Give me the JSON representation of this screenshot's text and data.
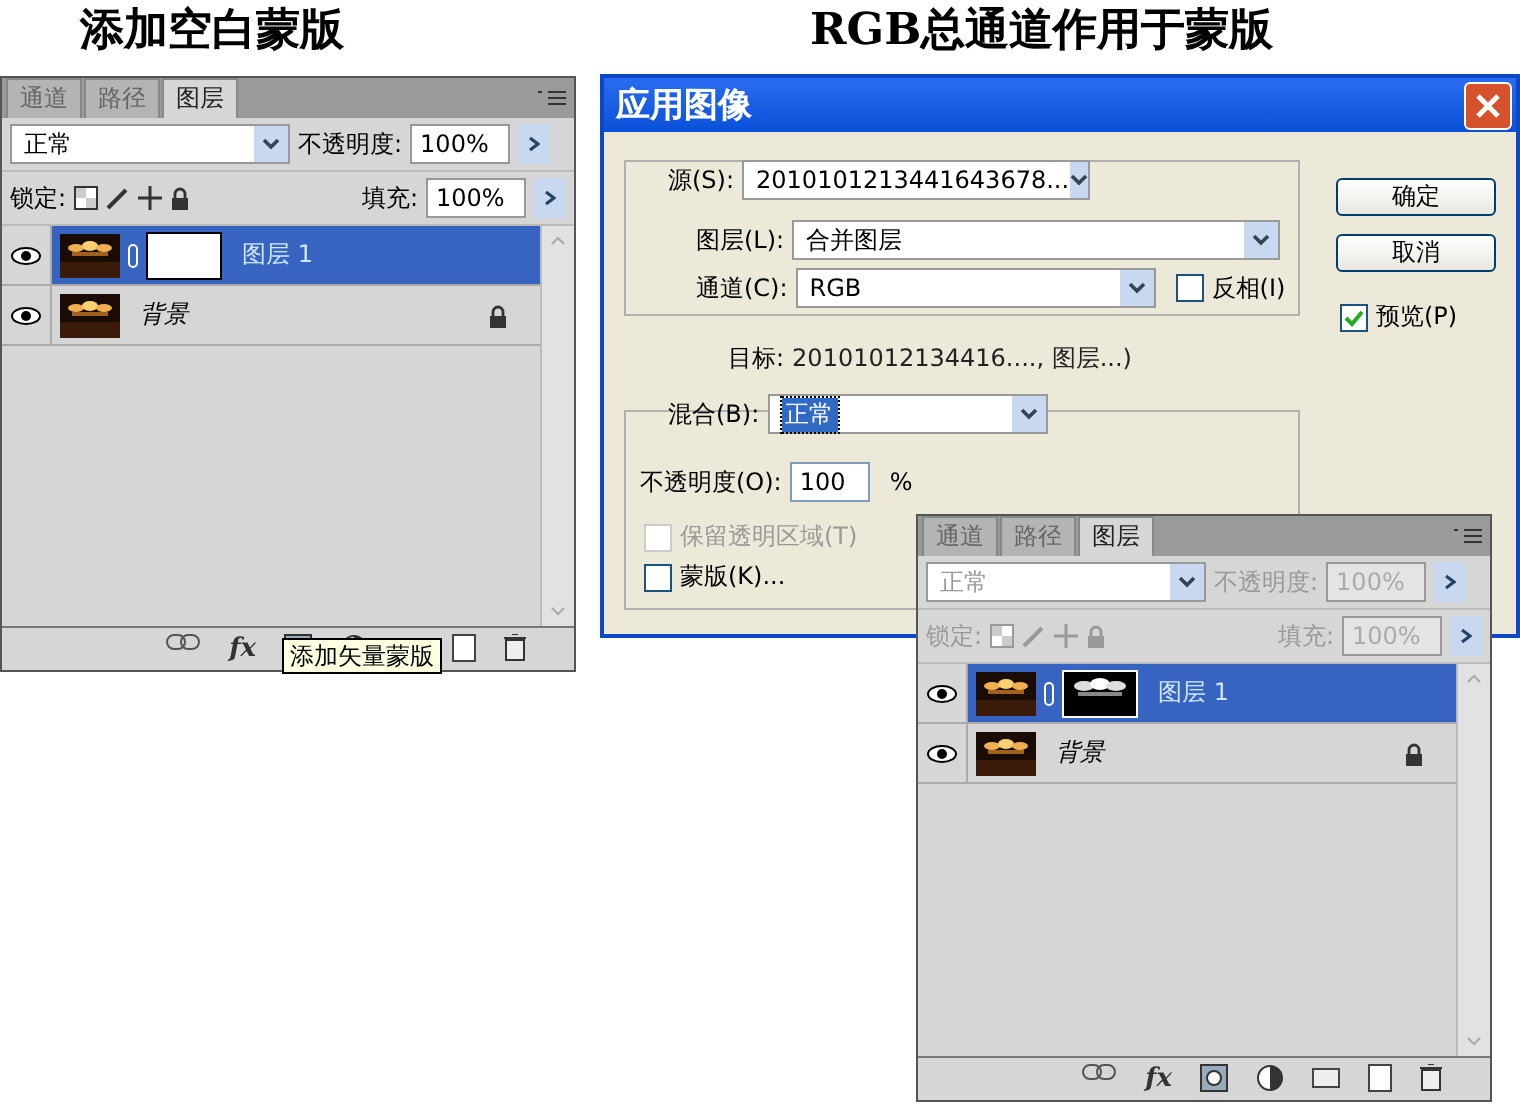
{
  "left_caption": "添加空白蒙版",
  "right_caption": "RGB总通道作用于蒙版",
  "panels": [
    {
      "tabs": [
        {
          "label": "通道",
          "selected": false
        },
        {
          "label": "路径",
          "selected": false
        },
        {
          "label": "图层",
          "selected": true
        }
      ],
      "blend_mode": "正常",
      "opacity_label": "不透明度:",
      "opacity": "100%",
      "lock_label": "锁定:",
      "fill_label": "填充:",
      "fill": "100%",
      "disabled": false,
      "effects_button": "fx",
      "layers": [
        {
          "name": "图层 1",
          "kind": "layer",
          "selected": true,
          "mask": {
            "kind": "blank"
          },
          "locked": false
        },
        {
          "name": "背景",
          "kind": "background",
          "selected": false,
          "locked": true
        }
      ],
      "tooltip": "添加矢量蒙版"
    },
    {
      "tabs": [
        {
          "label": "通道",
          "selected": false
        },
        {
          "label": "路径",
          "selected": false
        },
        {
          "label": "图层",
          "selected": true
        }
      ],
      "blend_mode": "正常",
      "opacity_label": "不透明度:",
      "opacity": "100%",
      "lock_label": "锁定:",
      "fill_label": "填充:",
      "fill": "100%",
      "disabled": true,
      "effects_button": "fx",
      "layers": [
        {
          "name": "图层 1",
          "kind": "layer",
          "selected": true,
          "locked": false
        },
        {
          "name": "背景",
          "kind": "background",
          "selected": false,
          "locked": true
        }
      ]
    }
  ],
  "dialog": {
    "title": "应用图像",
    "source_label": "源(S):",
    "source": "201010121344164367​8...",
    "layer_label": "图层(L):",
    "layer": "合并图层",
    "channel_label": "通道(C):",
    "channel": "RGB",
    "invert": {
      "label": "反相(I)",
      "checked": false
    },
    "ok": "确定",
    "cancel": "取消",
    "preview": {
      "label": "预览(P)",
      "checked": true
    },
    "target_label": "目标:",
    "target": "20101012134416...., 图层...)",
    "blend_label": "混合(B):",
    "blend": "正常",
    "blend_focused": true,
    "opacity_label": "不透明度(O):",
    "opacity": "100",
    "percent": "%",
    "preserve": {
      "label": "保留透明区域(T)",
      "checked": false,
      "disabled": true
    },
    "mask": {
      "label": "蒙版(K)...",
      "checked": false,
      "disabled": false
    }
  }
}
